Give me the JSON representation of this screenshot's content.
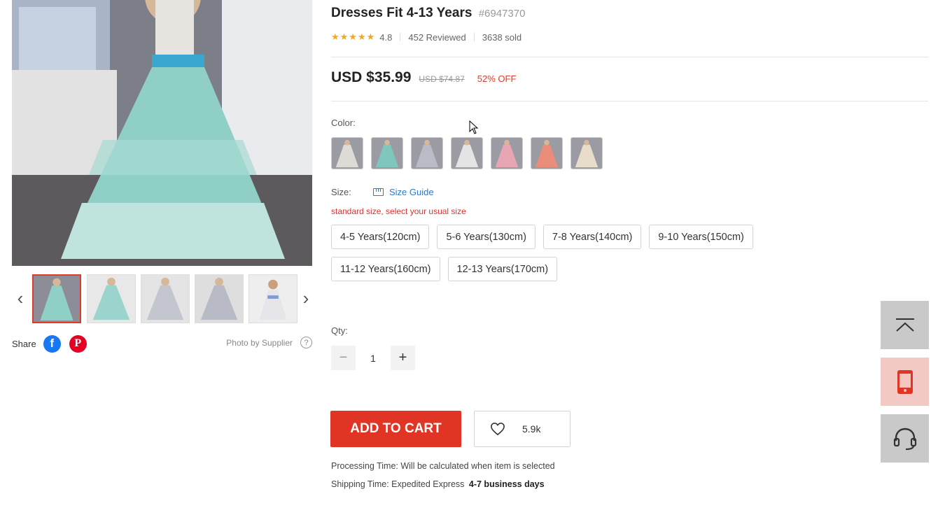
{
  "product": {
    "title": "Dresses Fit 4-13 Years",
    "sku": "#6947370",
    "rating": "4.8",
    "reviews": "452 Reviewed",
    "sold": "3638 sold",
    "price": "USD $35.99",
    "old_price": "USD $74.87",
    "discount": "52% OFF"
  },
  "options": {
    "color_label": "Color:",
    "size_label": "Size:",
    "size_guide": "Size Guide",
    "size_note": "standard size, select your usual size",
    "sizes": [
      "4-5 Years(120cm)",
      "5-6 Years(130cm)",
      "7-8 Years(140cm)",
      "9-10 Years(150cm)",
      "11-12 Years(160cm)",
      "12-13 Years(170cm)"
    ],
    "swatch_colors": [
      "#d9d6d2",
      "#7fc6bf",
      "#b9bcc6",
      "#dcdcdc",
      "#e8a6b5",
      "#e98d7a",
      "#e8dccb"
    ]
  },
  "qty": {
    "label": "Qty:",
    "value": "1",
    "minus": "−",
    "plus": "+"
  },
  "actions": {
    "add_to_cart": "ADD TO CART",
    "wishlist_count": "5.9k"
  },
  "shipping": {
    "processing_label": "Processing Time:",
    "processing_value": "Will be calculated when item is selected",
    "shipping_label": "Shipping Time:",
    "shipping_method": "Expedited Express",
    "shipping_days": "4-7 business days"
  },
  "gallery": {
    "share_label": "Share",
    "photo_by": "Photo by Supplier",
    "help_icon_text": "?",
    "prev_icon": "‹",
    "next_icon": "›",
    "facebook_glyph": "f",
    "pinterest_glyph": "P"
  },
  "colors": {
    "accent": "#e03424",
    "link": "#2a7bc9",
    "star": "#f5a623"
  }
}
